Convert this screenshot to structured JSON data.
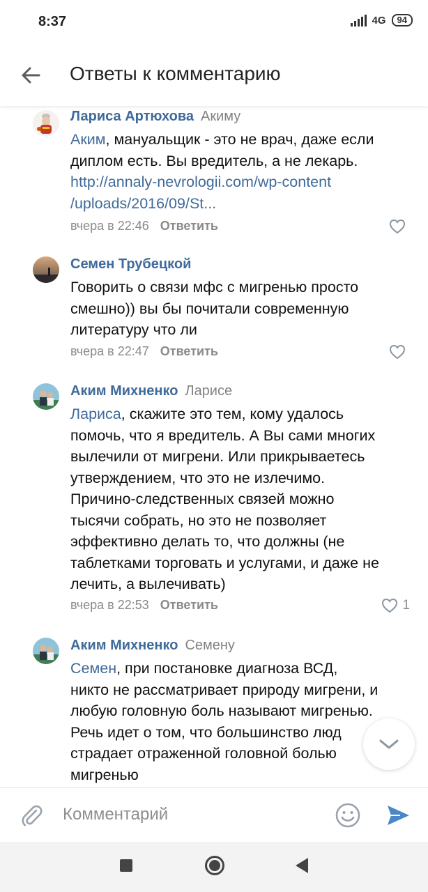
{
  "status_bar": {
    "time": "8:37",
    "network": "4G",
    "battery": "94"
  },
  "header": {
    "title": "Ответы к комментарию",
    "back_icon": "arrow-left-icon"
  },
  "comments": [
    {
      "author": "Лариса Артюхова",
      "reply_to": "Акиму",
      "mention": "Аким",
      "text_lines": [
        ", мануальщик - это не врач, даже если",
        "диплом есть. Вы вредитель, а не лекарь."
      ],
      "link_lines": [
        "http://annaly-nevrologii.com/wp-content",
        "/uploads/2016/09/St..."
      ],
      "time": "вчера в 22:46",
      "reply_label": "Ответить",
      "likes": ""
    },
    {
      "author": "Семен Трубецкой",
      "reply_to": "",
      "text_lines": [
        "Говорить о связи мфс с мигренью просто",
        "смешно)) вы бы почитали современную",
        "литературу что ли"
      ],
      "time": "вчера в 22:47",
      "reply_label": "Ответить",
      "likes": ""
    },
    {
      "author": "Аким Михненко",
      "reply_to": "Ларисе",
      "mention": "Лариса",
      "text_lines": [
        ", скажите это тем, кому удалось",
        "помочь, что я вредитель. А Вы сами многих",
        "вылечили от мигрени. Или прикрываетесь",
        "утверждением, что это не излечимо.",
        "Причино-следственных связей можно",
        "тысячи собрать, но это не позволяет",
        "эффективно делать то, что должны (не",
        "таблетками торговать и услугами, и даже не",
        "лечить, а вылечивать)"
      ],
      "time": "вчера в 22:53",
      "reply_label": "Ответить",
      "likes": "1"
    },
    {
      "author": "Аким Михненко",
      "reply_to": "Семену",
      "mention": "Семен",
      "text_lines": [
        ", при постановке диагноза ВСД,",
        "никто не рассматривает природу мигрени, и",
        "любую головную боль называют мигренью.",
        "Речь идет о том, что большинство люд",
        "страдает отраженной головной болью",
        "мигренью"
      ]
    }
  ],
  "composer": {
    "placeholder": "Комментарий",
    "attach_icon": "paperclip-icon",
    "emoji_icon": "smile-icon",
    "send_icon": "send-icon"
  },
  "scroll_button_icon": "chevron-down-icon",
  "colors": {
    "accent": "#3f6a9a",
    "secondary_text": "#8a8a8a",
    "send": "#4a86c8"
  }
}
